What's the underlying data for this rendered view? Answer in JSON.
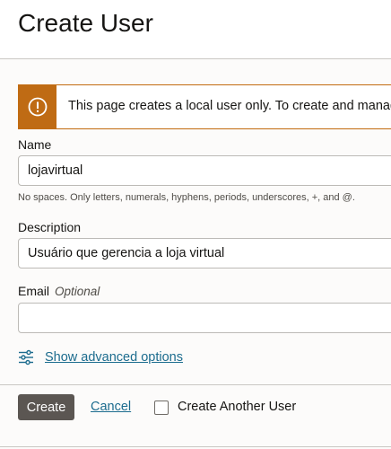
{
  "page": {
    "title": "Create User"
  },
  "notice": {
    "icon": "warning-icon",
    "text": "This page creates a local user only. To create and manage"
  },
  "form": {
    "name": {
      "label": "Name",
      "value": "lojavirtual",
      "hint": "No spaces. Only letters, numerals, hyphens, periods, underscores, +, and @."
    },
    "description": {
      "label": "Description",
      "value": "Usuário que gerencia a loja virtual"
    },
    "email": {
      "label": "Email",
      "optional": "Optional",
      "value": ""
    },
    "advanced": {
      "icon": "sliders-icon",
      "label": "Show advanced options"
    }
  },
  "footer": {
    "create_label": "Create",
    "cancel_label": "Cancel",
    "create_another_label": "Create Another User",
    "create_another_checked": false
  },
  "colors": {
    "accent_link": "#1c6c8e",
    "warning": "#bf6b14",
    "primary_button": "#5b5652"
  }
}
